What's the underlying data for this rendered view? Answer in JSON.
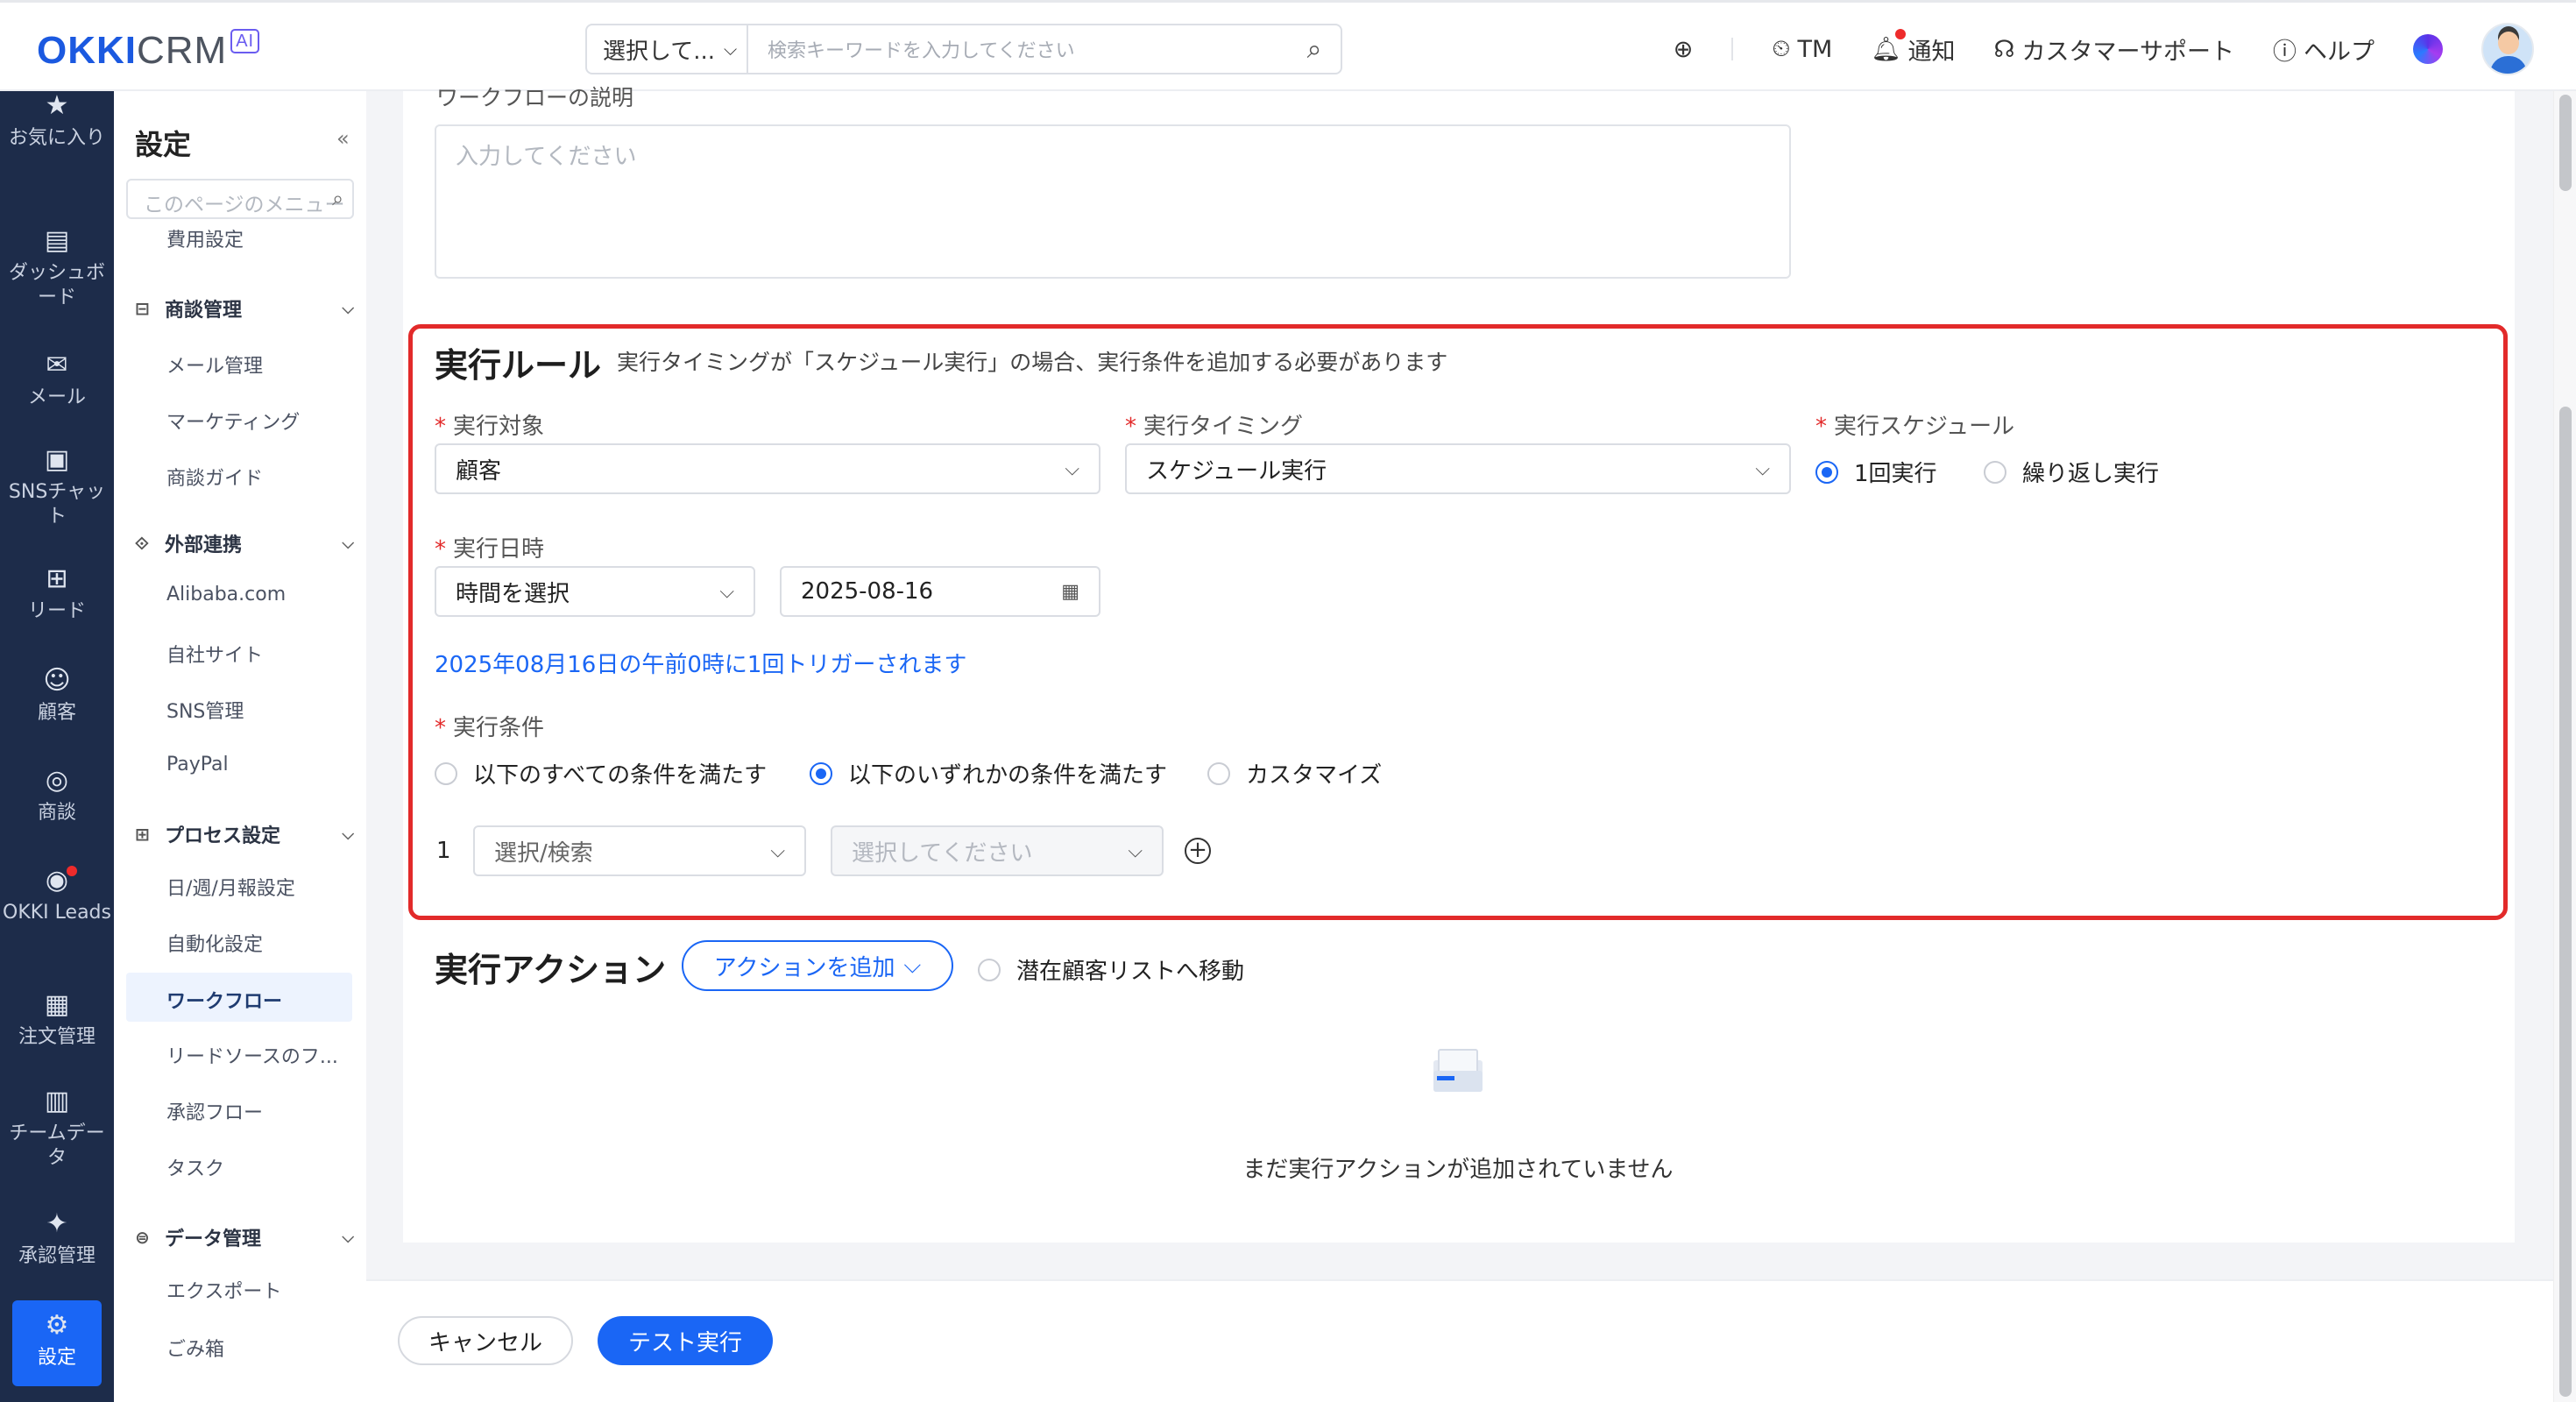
{
  "header": {
    "logo_brand": "OKKI",
    "logo_suffix": "CRM",
    "logo_badge": "AI",
    "search_scope": "選択して...",
    "search_placeholder": "検索キーワードを入力してください",
    "tm": "TM",
    "notice": "通知",
    "support": "カスタマーサポート",
    "help": "ヘルプ"
  },
  "leftnav": {
    "favorites": "お気に入り",
    "dashboard": "ダッシュボード",
    "mail": "メール",
    "sns": "SNSチャット",
    "leads": "リード",
    "customers": "顧客",
    "deals": "商談",
    "okki_leads": "OKKI Leads",
    "orders": "注文管理",
    "team_data": "チームデータ",
    "approval": "承認管理",
    "settings": "設定"
  },
  "settings_menu": {
    "title": "設定",
    "search_placeholder": "このページのメニュー",
    "items": {
      "cost": "費用設定",
      "group_deal": "商談管理",
      "mail_mgmt": "メール管理",
      "marketing": "マーケティング",
      "deal_guide": "商談ガイド",
      "group_external": "外部連携",
      "alibaba": "Alibaba.com",
      "own_site": "自社サイト",
      "sns_mgmt": "SNS管理",
      "paypal": "PayPal",
      "group_process": "プロセス設定",
      "report": "日/週/月報設定",
      "automation": "自動化設定",
      "workflow": "ワークフロー",
      "lead_source": "リードソースのフ...",
      "approval_flow": "承認フロー",
      "task": "タスク",
      "group_data": "データ管理",
      "export": "エクスポート",
      "trash": "ごみ箱"
    }
  },
  "form": {
    "desc_label": "ワークフローの説明",
    "desc_placeholder": "入力してください",
    "rule_title": "実行ルール",
    "rule_note": "実行タイミングが「スケジュール実行」の場合、実行条件を追加する必要があります",
    "target_label": "実行対象",
    "target_value": "顧客",
    "timing_label": "実行タイミング",
    "timing_value": "スケジュール実行",
    "schedule_label": "実行スケジュール",
    "schedule_once": "1回実行",
    "schedule_repeat": "繰り返し実行",
    "datetime_label": "実行日時",
    "time_value": "時間を選択",
    "date_value": "2025-08-16",
    "trigger_text": "2025年08月16日の午前0時に1回トリガーされます",
    "cond_label": "実行条件",
    "cond_all": "以下のすべての条件を満たす",
    "cond_any": "以下のいずれかの条件を満たす",
    "cond_custom": "カスタマイズ",
    "cond_row_no": "1",
    "cond_field": "選択/検索",
    "cond_value": "選択してください",
    "action_title": "実行アクション",
    "add_action": "アクションを追加",
    "move_pool": "潜在顧客リストへ移動",
    "empty_text": "まだ実行アクションが追加されていません"
  },
  "footer": {
    "cancel": "キャンセル",
    "test_run": "テスト実行"
  }
}
